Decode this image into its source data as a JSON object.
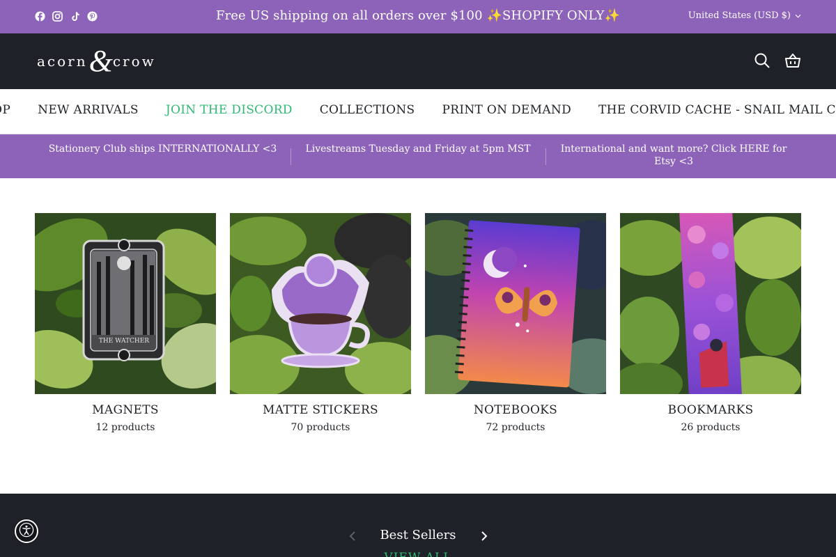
{
  "announcement": {
    "text": "Free US shipping on all orders over $100 ✨SHOPIFY ONLY✨",
    "currency": "United States (USD $)",
    "social_icons": [
      "facebook-icon",
      "instagram-icon",
      "tiktok-icon",
      "pinterest-icon"
    ]
  },
  "header": {
    "logo_left": "acorn",
    "logo_amp": "&",
    "logo_right": "crow",
    "icons": [
      "search-icon",
      "cart-icon"
    ]
  },
  "nav": {
    "items": [
      {
        "label": "SHOP"
      },
      {
        "label": "NEW ARRIVALS"
      },
      {
        "label": "JOIN THE DISCORD"
      },
      {
        "label": "COLLECTIONS"
      },
      {
        "label": "PRINT ON DEMAND"
      },
      {
        "label": "THE CORVID CACHE - SNAIL MAIL CLUB"
      }
    ]
  },
  "promo": {
    "items": [
      {
        "text": "Stationery Club ships INTERNATIONALLY <3"
      },
      {
        "text": "Livestreams Tuesday and Friday at 5pm MST"
      },
      {
        "text": "International and want more? Click HERE for Etsy <3"
      }
    ]
  },
  "collections": [
    {
      "title": "MAGNETS",
      "count": "12 products",
      "image": "tarot-card-magnet"
    },
    {
      "title": "MATTE STICKERS",
      "count": "70 products",
      "image": "dragon-teacup-sticker"
    },
    {
      "title": "NOTEBOOKS",
      "count": "72 products",
      "image": "moth-moon-notebook"
    },
    {
      "title": "BOOKMARKS",
      "count": "26 products",
      "image": "purple-floral-bookmark"
    }
  ],
  "bestsellers": {
    "title": "Best Sellers",
    "view_all": "VIEW ALL"
  },
  "colors": {
    "brand_purple": "#8c63b8",
    "header_dark": "#1e2228",
    "accent_green": "#2eb872"
  }
}
